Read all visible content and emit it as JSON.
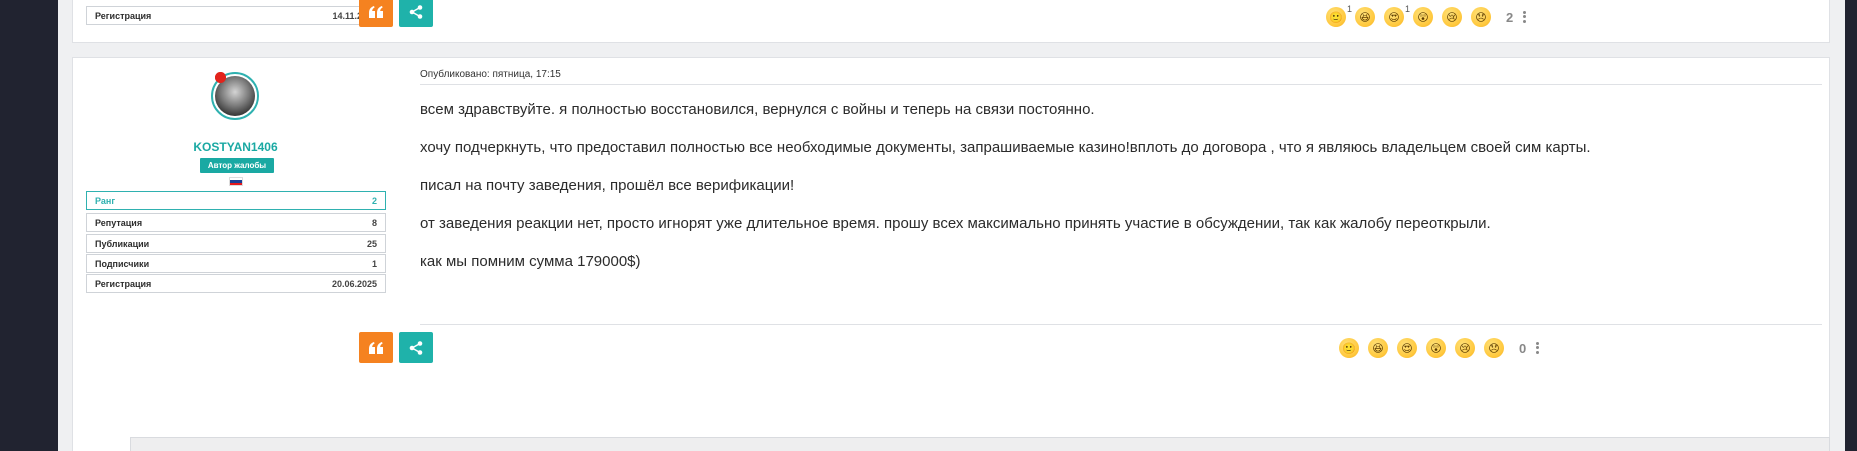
{
  "prev_post": {
    "registration_label": "Регистрация",
    "registration_date": "14.11.2015",
    "reactions": [
      {
        "icon": "smile-emoji-icon",
        "glyph": "🙂",
        "count": "1"
      },
      {
        "icon": "laugh-emoji-icon",
        "glyph": "😆",
        "count": ""
      },
      {
        "icon": "heart-eyes-emoji-icon",
        "glyph": "😍",
        "count": "1"
      },
      {
        "icon": "wow-emoji-icon",
        "glyph": "😲",
        "count": ""
      },
      {
        "icon": "cry-emoji-icon",
        "glyph": "😢",
        "count": ""
      },
      {
        "icon": "sad-emoji-icon",
        "glyph": "😞",
        "count": ""
      }
    ],
    "total": "2"
  },
  "post": {
    "author": {
      "username": "KOSTYAN1406",
      "badge": "Автор жалобы",
      "flag_colors": [
        "#ffffff",
        "#1c3f94",
        "#e4181c"
      ],
      "stats": [
        {
          "label": "Ранг",
          "value": "2"
        },
        {
          "label": "Репутация",
          "value": "8"
        },
        {
          "label": "Публикации",
          "value": "25"
        },
        {
          "label": "Подписчики",
          "value": "1"
        },
        {
          "label": "Регистрация",
          "value": "20.06.2025"
        }
      ]
    },
    "published": "Опубликовано: пятница, 17:15",
    "paragraphs": [
      "всем здравствуйте. я полностью восстановился, вернулся с войны и теперь на связи постоянно.",
      "хочу подчеркнуть, что предоставил полностью все необходимые документы, запрашиваемые казино!вплоть до договора , что я являюсь владельцем своей сим карты.",
      "писал на почту заведения, прошёл все верификации!",
      "от заведения реакции нет, просто игнорят уже длительное время. прошу всех максимально принять участие в обсуждении, так как жалобу переоткрыли.",
      "как мы помним сумма 179000$)"
    ],
    "reactions": [
      {
        "icon": "smile-emoji-icon",
        "glyph": "🙂"
      },
      {
        "icon": "laugh-emoji-icon",
        "glyph": "😆"
      },
      {
        "icon": "heart-eyes-emoji-icon",
        "glyph": "😍"
      },
      {
        "icon": "wow-emoji-icon",
        "glyph": "😲"
      },
      {
        "icon": "cry-emoji-icon",
        "glyph": "😢"
      },
      {
        "icon": "sad-emoji-icon",
        "glyph": "😞"
      }
    ],
    "total": "0"
  },
  "colors": {
    "accent": "#1aa9a3",
    "quote_button": "#f58220",
    "share_button": "#1fb2aa",
    "online": "#e2241c"
  }
}
